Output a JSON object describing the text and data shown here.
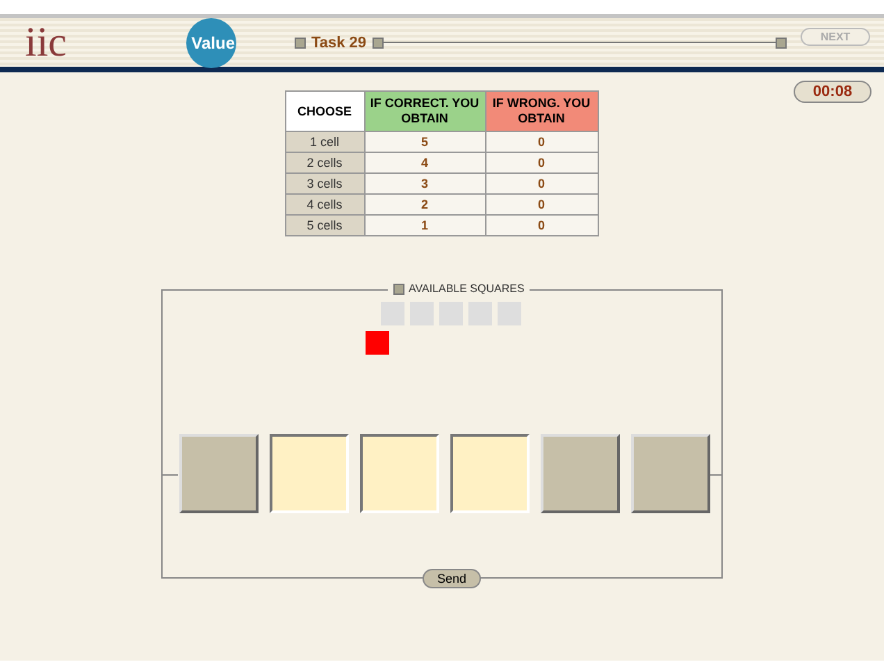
{
  "header": {
    "logo": "iic",
    "badge": "Value",
    "task": "Task 29",
    "next_button": {
      "label": "NEXT",
      "disabled": true
    },
    "timer": "00:08"
  },
  "table": {
    "columns": [
      "CHOOSE",
      "IF CORRECT. YOU OBTAIN",
      "IF WRONG. YOU OBTAIN"
    ],
    "rows": [
      [
        "1 cell",
        "5",
        "0"
      ],
      [
        "2 cells",
        "4",
        "0"
      ],
      [
        "3 cells",
        "3",
        "0"
      ],
      [
        "4 cells",
        "2",
        "0"
      ],
      [
        "5 cells",
        "1",
        "0"
      ]
    ]
  },
  "board": {
    "title": "AVAILABLE SQUARES",
    "available": [
      {
        "used": false
      },
      {
        "used": false
      },
      {
        "used": false
      },
      {
        "used": false
      },
      {
        "used": false
      }
    ],
    "pending_square": true,
    "cells": [
      {
        "selected": false
      },
      {
        "selected": true
      },
      {
        "selected": true
      },
      {
        "selected": true
      },
      {
        "selected": false
      },
      {
        "selected": false
      }
    ]
  },
  "send_button": "Send"
}
